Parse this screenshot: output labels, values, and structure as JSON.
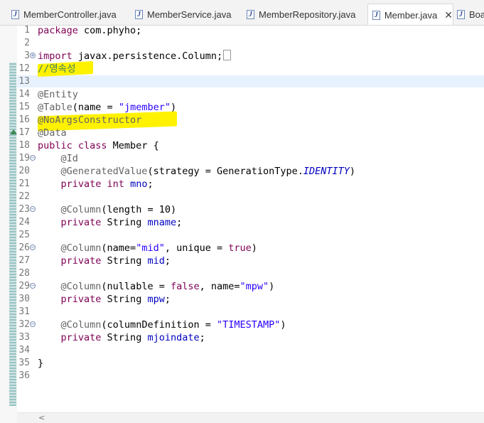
{
  "tabs": [
    {
      "label": "MemberController.java",
      "active": false
    },
    {
      "label": "MemberService.java",
      "active": false
    },
    {
      "label": "MemberRepository.java",
      "active": false
    },
    {
      "label": "Member.java",
      "active": true
    },
    {
      "label": "Boar",
      "active": false
    }
  ],
  "close_glyph": "✕",
  "lines": [
    {
      "n": "1",
      "tokens": [
        [
          "kw",
          "package"
        ],
        [
          "plain",
          " com.phyho;"
        ]
      ]
    },
    {
      "n": "2",
      "tokens": []
    },
    {
      "n": "3",
      "fold": "plus",
      "tokens": [
        [
          "kw",
          "import"
        ],
        [
          "plain",
          " javax.persistence.Column;"
        ]
      ],
      "collapsed": true
    },
    {
      "n": "12",
      "tokens": [
        [
          "cmt",
          "//영속성"
        ]
      ]
    },
    {
      "n": "13",
      "tokens": []
    },
    {
      "n": "14",
      "tokens": [
        [
          "ann",
          "@Entity"
        ]
      ]
    },
    {
      "n": "15",
      "tokens": [
        [
          "ann",
          "@Table"
        ],
        [
          "plain",
          "(name = "
        ],
        [
          "str",
          "\"jmember\""
        ],
        [
          "plain",
          ")"
        ]
      ]
    },
    {
      "n": "16",
      "tokens": [
        [
          "ann",
          "@NoArgsConstructor"
        ]
      ]
    },
    {
      "n": "17",
      "tokens": [
        [
          "ann",
          "@Data"
        ]
      ]
    },
    {
      "n": "18",
      "tokens": [
        [
          "kw",
          "public class"
        ],
        [
          "plain",
          " Member {"
        ]
      ]
    },
    {
      "n": "19",
      "fold": "minus",
      "tokens": [
        [
          "plain",
          "    "
        ],
        [
          "ann",
          "@Id"
        ]
      ]
    },
    {
      "n": "20",
      "tokens": [
        [
          "plain",
          "    "
        ],
        [
          "ann",
          "@GeneratedValue"
        ],
        [
          "plain",
          "(strategy = GenerationType."
        ],
        [
          "italic-fld",
          "IDENTITY"
        ],
        [
          "plain",
          ")"
        ]
      ]
    },
    {
      "n": "21",
      "tokens": [
        [
          "plain",
          "    "
        ],
        [
          "kw",
          "private int"
        ],
        [
          "plain",
          " "
        ],
        [
          "fld",
          "mno"
        ],
        [
          "plain",
          ";"
        ]
      ]
    },
    {
      "n": "22",
      "tokens": []
    },
    {
      "n": "23",
      "fold": "minus",
      "tokens": [
        [
          "plain",
          "    "
        ],
        [
          "ann",
          "@Column"
        ],
        [
          "plain",
          "(length = 10)"
        ]
      ]
    },
    {
      "n": "24",
      "tokens": [
        [
          "plain",
          "    "
        ],
        [
          "kw",
          "private"
        ],
        [
          "plain",
          " String "
        ],
        [
          "fld",
          "mname"
        ],
        [
          "plain",
          ";"
        ]
      ]
    },
    {
      "n": "25",
      "tokens": []
    },
    {
      "n": "26",
      "fold": "minus",
      "tokens": [
        [
          "plain",
          "    "
        ],
        [
          "ann",
          "@Column"
        ],
        [
          "plain",
          "(name="
        ],
        [
          "str",
          "\"mid\""
        ],
        [
          "plain",
          ", unique = "
        ],
        [
          "kw",
          "true"
        ],
        [
          "plain",
          ")"
        ]
      ]
    },
    {
      "n": "27",
      "tokens": [
        [
          "plain",
          "    "
        ],
        [
          "kw",
          "private"
        ],
        [
          "plain",
          " String "
        ],
        [
          "fld",
          "mid"
        ],
        [
          "plain",
          ";"
        ]
      ]
    },
    {
      "n": "28",
      "tokens": []
    },
    {
      "n": "29",
      "fold": "minus",
      "tokens": [
        [
          "plain",
          "    "
        ],
        [
          "ann",
          "@Column"
        ],
        [
          "plain",
          "(nullable = "
        ],
        [
          "kw",
          "false"
        ],
        [
          "plain",
          ", name="
        ],
        [
          "str",
          "\"mpw\""
        ],
        [
          "plain",
          ")"
        ]
      ]
    },
    {
      "n": "30",
      "tokens": [
        [
          "plain",
          "    "
        ],
        [
          "kw",
          "private"
        ],
        [
          "plain",
          " String "
        ],
        [
          "fld",
          "mpw"
        ],
        [
          "plain",
          ";"
        ]
      ]
    },
    {
      "n": "31",
      "tokens": []
    },
    {
      "n": "32",
      "fold": "minus",
      "tokens": [
        [
          "plain",
          "    "
        ],
        [
          "ann",
          "@Column"
        ],
        [
          "plain",
          "(columnDefinition = "
        ],
        [
          "str",
          "\"TIMESTAMP\""
        ],
        [
          "plain",
          ")"
        ]
      ]
    },
    {
      "n": "33",
      "tokens": [
        [
          "plain",
          "    "
        ],
        [
          "kw",
          "private"
        ],
        [
          "plain",
          " String "
        ],
        [
          "fld",
          "mjoindate"
        ],
        [
          "plain",
          ";"
        ]
      ]
    },
    {
      "n": "34",
      "tokens": []
    },
    {
      "n": "35",
      "tokens": [
        [
          "plain",
          "}"
        ]
      ]
    },
    {
      "n": "36",
      "tokens": []
    }
  ],
  "scroll_left_glyph": "<",
  "colors": {
    "keyword": "#7f0055",
    "annotation": "#646464",
    "string": "#2a00ff",
    "field": "#0000c0",
    "comment": "#3f7f5f",
    "highlight": "#fff200"
  }
}
